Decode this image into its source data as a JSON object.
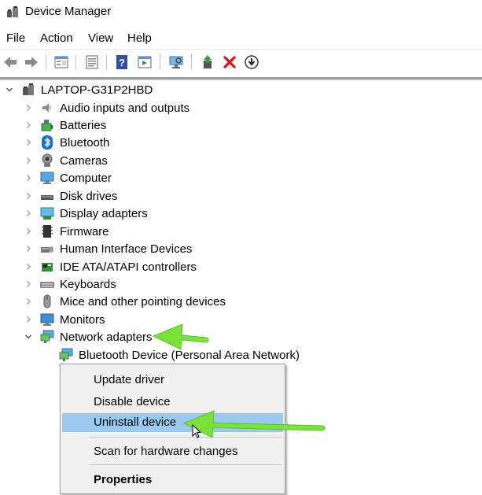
{
  "window": {
    "title": "Device Manager"
  },
  "menu": [
    {
      "label": "File"
    },
    {
      "label": "Action"
    },
    {
      "label": "View"
    },
    {
      "label": "Help"
    }
  ],
  "toolbar": {
    "buttons": [
      "back-arrow-icon",
      "forward-arrow-icon",
      "properties-icon",
      "details-icon",
      "help-icon",
      "view-icon",
      "scan-monitor-icon",
      "update-driver-icon",
      "uninstall-x-icon",
      "download-icon"
    ]
  },
  "tree": {
    "root": "LAPTOP-G31P2HBD",
    "categories": [
      {
        "label": "Audio inputs and outputs",
        "icon": "speaker-icon"
      },
      {
        "label": "Batteries",
        "icon": "battery-icon"
      },
      {
        "label": "Bluetooth",
        "icon": "bluetooth-icon"
      },
      {
        "label": "Cameras",
        "icon": "camera-icon"
      },
      {
        "label": "Computer",
        "icon": "computer-icon"
      },
      {
        "label": "Disk drives",
        "icon": "disk-drive-icon"
      },
      {
        "label": "Display adapters",
        "icon": "display-adapter-icon"
      },
      {
        "label": "Firmware",
        "icon": "firmware-icon"
      },
      {
        "label": "Human Interface Devices",
        "icon": "hid-icon"
      },
      {
        "label": "IDE ATA/ATAPI controllers",
        "icon": "ide-controller-icon"
      },
      {
        "label": "Keyboards",
        "icon": "keyboard-icon"
      },
      {
        "label": "Mice and other pointing devices",
        "icon": "mouse-icon"
      },
      {
        "label": "Monitors",
        "icon": "monitor-icon"
      },
      {
        "label": "Network adapters",
        "icon": "network-adapter-icon"
      }
    ],
    "network_children": [
      {
        "label": "Bluetooth Device (Personal Area Network)"
      }
    ]
  },
  "context_menu": {
    "items": [
      {
        "label": "Update driver"
      },
      {
        "label": "Disable device"
      },
      {
        "label": "Uninstall device"
      },
      {
        "label": "Scan for hardware changes"
      },
      {
        "label": "Properties"
      }
    ],
    "highlight_color": "#99c9ef"
  },
  "annotation_color": "#7be23a"
}
